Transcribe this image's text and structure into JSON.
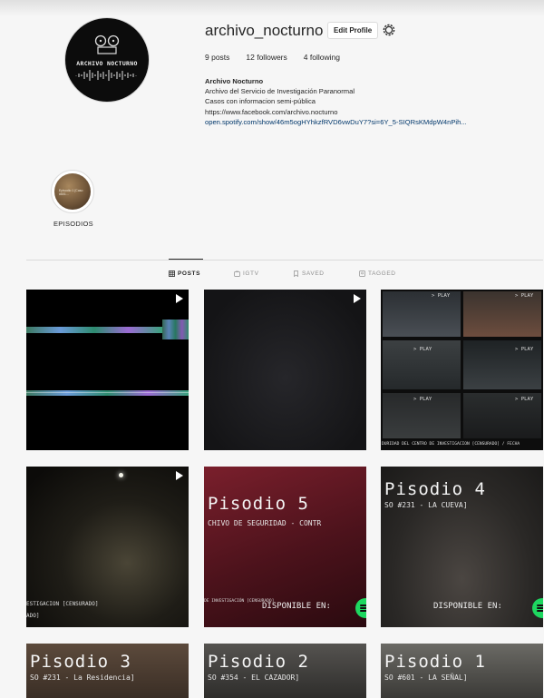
{
  "profile": {
    "username": "archivo_nocturno",
    "edit_label": "Edit Profile",
    "avatar_text": "ARCHIVO NOCTURNO",
    "stats": {
      "posts": "9 posts",
      "followers": "12 followers",
      "following": "4 following"
    },
    "bio": {
      "name": "Archivo Nocturno",
      "line1": "Archivo del Servicio de Investigación Paranormal",
      "line2": "Casos con informacion semi-pública",
      "line3": "https://www.facebook.com/archivo.nocturno",
      "link": "open.spotify.com/show/46m5ogHYhkzfRVD6vwDuY7?si=6Y_5-SIQRsKMdpW4nPih..."
    }
  },
  "highlight": {
    "label": "EPISODIOS",
    "thumb_text": "Episodio 1 [Caso #601..."
  },
  "tabs": [
    {
      "label": "POSTS",
      "icon": "grid-icon",
      "active": true
    },
    {
      "label": "IGTV",
      "icon": "igtv-icon",
      "active": false
    },
    {
      "label": "SAVED",
      "icon": "bookmark-icon",
      "active": false
    },
    {
      "label": "TAGGED",
      "icon": "tag-icon",
      "active": false
    }
  ],
  "posts": [
    {
      "kind": "glitch",
      "video": true
    },
    {
      "kind": "static",
      "video": true
    },
    {
      "kind": "collage",
      "video": false,
      "play_label": "> PLAY",
      "caption": "DURIDAD DEL CENTRO DE INVESTIGACION [CENSURADO] / FECHA"
    },
    {
      "kind": "corridor",
      "video": true,
      "caption1": "ESTIGACION [CENSURADO]",
      "caption2": "ADO]"
    },
    {
      "kind": "episode",
      "title": "Pisodio 5",
      "subtitle": "CHIVO DE SEGURIDAD - CONTR",
      "availability": "DISPONIBLE EN:",
      "caption": "DE INVESTIGACIÓN [CENSURADO]"
    },
    {
      "kind": "episode",
      "title": "Pisodio 4",
      "subtitle": "SO #231 - LA CUEVA]",
      "availability": "DISPONIBLE EN:"
    },
    {
      "kind": "episode",
      "title": "Pisodio 3",
      "subtitle": "SO #231 - La Residencia]"
    },
    {
      "kind": "episode",
      "title": "Pisodio 2",
      "subtitle": "SO #354 - EL CAZADOR]"
    },
    {
      "kind": "episode",
      "title": "Pisodio 1",
      "subtitle": "SO #601 - LA SEÑAL]"
    }
  ],
  "colors": {
    "link": "#00376b",
    "spotify": "#1ed760",
    "ep5_bg": "#5a1620",
    "ep4_bg": "#2e2c2a",
    "ep3_bg": "#4a3b30"
  }
}
